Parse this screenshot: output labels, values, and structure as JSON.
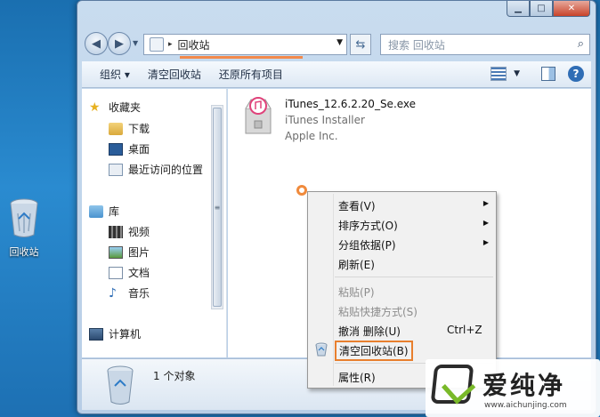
{
  "desktop": {
    "recycle_bin_label": "回收站"
  },
  "window": {
    "caption": {
      "min": "▁",
      "max": "□",
      "close": "✕"
    },
    "address": {
      "path": "回收站",
      "separator": "▸"
    },
    "search_placeholder": "搜索 回收站"
  },
  "toolbar": {
    "organize": "组织 ▾",
    "empty_bin": "清空回收站",
    "restore_all": "还原所有项目",
    "help": "?"
  },
  "navpane": {
    "favorites": "收藏夹",
    "downloads": "下载",
    "desktop": "桌面",
    "recent": "最近访问的位置",
    "libraries": "库",
    "videos": "视频",
    "pictures": "图片",
    "documents": "文档",
    "music": "音乐",
    "computer": "计算机"
  },
  "file": {
    "name": "iTunes_12.6.2.20_Se.exe",
    "description": "iTunes Installer",
    "company": "Apple Inc."
  },
  "details": {
    "count": "1 个对象"
  },
  "context_menu": {
    "view": "查看(V)",
    "sort": "排序方式(O)",
    "group": "分组依据(P)",
    "refresh": "刷新(E)",
    "paste": "粘贴(P)",
    "paste_shortcut": "粘贴快捷方式(S)",
    "undo": "撤消 删除(U)",
    "undo_shortcut": "Ctrl+Z",
    "empty_bin": "清空回收站(B)",
    "properties": "属性(R)"
  },
  "watermark": {
    "brand": "爱纯净",
    "url": "www.aichunjing.com"
  },
  "colors": {
    "accent_orange": "#e87f2e",
    "desktop_blue": "#1d70b3",
    "logo_green": "#79b929"
  }
}
